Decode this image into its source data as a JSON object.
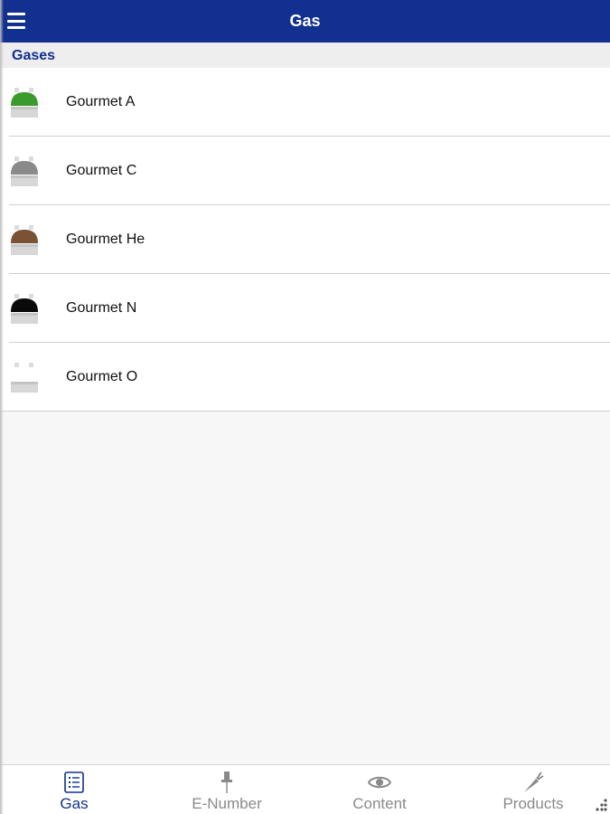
{
  "navbar": {
    "title": "Gas",
    "menu_icon": "hamburger-menu-icon",
    "color": "#11308f"
  },
  "section": {
    "header": "Gases"
  },
  "gases": [
    {
      "label": "Gourmet A",
      "icon": "cylinder-icon",
      "cap_color": "#3a9a2e"
    },
    {
      "label": "Gourmet C",
      "icon": "cylinder-icon",
      "cap_color": "#8a8a8a"
    },
    {
      "label": "Gourmet He",
      "icon": "cylinder-icon",
      "cap_color": "#7a5236"
    },
    {
      "label": "Gourmet N",
      "icon": "cylinder-icon",
      "cap_color": "#0a0a0a"
    },
    {
      "label": "Gourmet O",
      "icon": "cylinder-icon",
      "cap_color": "#ffffff"
    }
  ],
  "tabs": [
    {
      "label": "Gas",
      "icon": "list-icon",
      "active": true
    },
    {
      "label": "E-Number",
      "icon": "pin-icon",
      "active": false
    },
    {
      "label": "Content",
      "icon": "eye-icon",
      "active": false
    },
    {
      "label": "Products",
      "icon": "carrot-icon",
      "active": false
    }
  ],
  "colors": {
    "accent": "#11308f",
    "inactive_tab": "#8a8a8a"
  }
}
